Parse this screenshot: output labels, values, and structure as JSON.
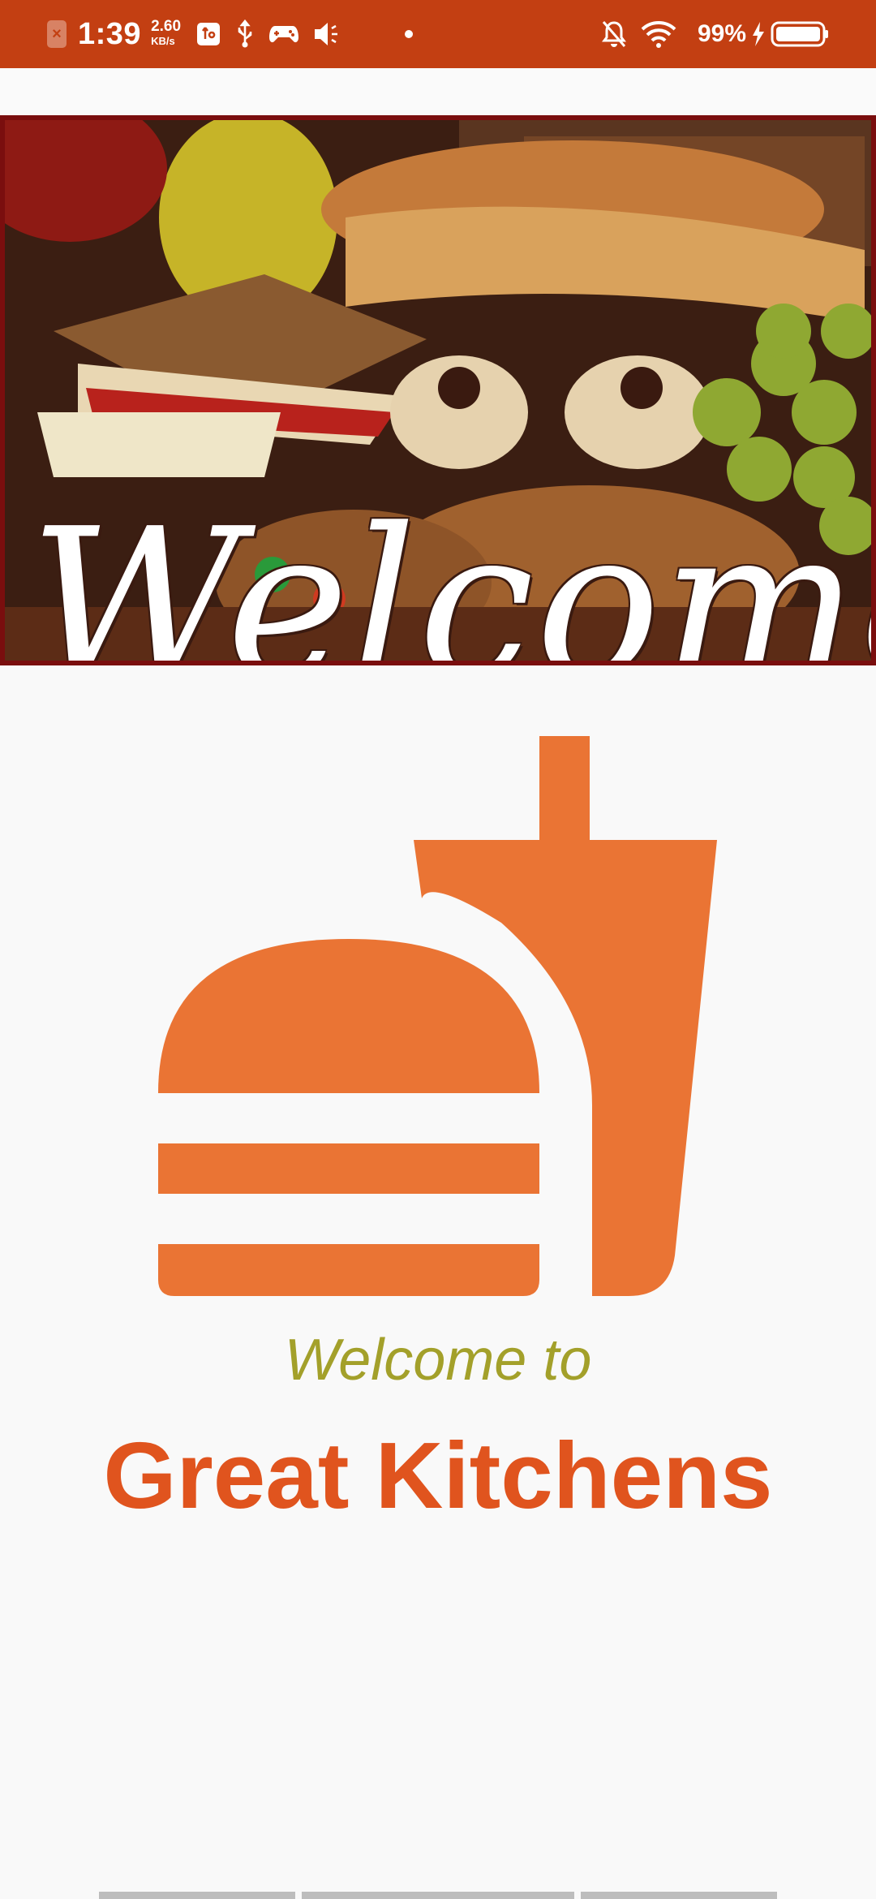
{
  "status_bar": {
    "time": "1:39",
    "net_speed_value": "2.60",
    "net_speed_unit": "KB/s",
    "battery": "99%",
    "icons": [
      "notification-x-icon",
      "usb-debug-icon",
      "usb-icon",
      "gamepad-icon",
      "volume-icon",
      "dot-icon",
      "mute-bell-icon",
      "wifi-icon",
      "charging-icon",
      "battery-icon"
    ]
  },
  "banner": {
    "text": "Welcome!"
  },
  "logo": {
    "icon": "burger-drink-icon",
    "color": "#ea7434"
  },
  "welcome": {
    "line1": "Welcome to",
    "title": "Great Kitchens"
  },
  "colors": {
    "status_bar": "#c33f12",
    "accent_olive": "#a3a02a",
    "brand_orange": "#e0541e"
  }
}
